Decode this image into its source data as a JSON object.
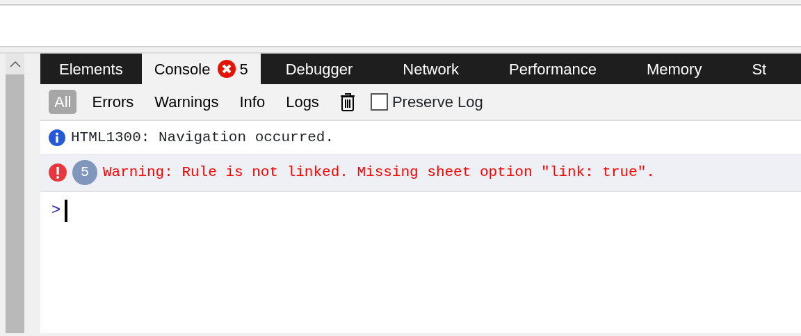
{
  "tabs": [
    {
      "label": "Elements",
      "selected": false
    },
    {
      "label": "Console",
      "selected": true,
      "error_count": "5"
    },
    {
      "label": "Debugger",
      "selected": false
    },
    {
      "label": "Network",
      "selected": false
    },
    {
      "label": "Performance",
      "selected": false
    },
    {
      "label": "Memory",
      "selected": false
    },
    {
      "label": "St",
      "selected": false
    }
  ],
  "filters": [
    {
      "label": "All",
      "selected": true
    },
    {
      "label": "Errors",
      "selected": false
    },
    {
      "label": "Warnings",
      "selected": false
    },
    {
      "label": "Info",
      "selected": false
    },
    {
      "label": "Logs",
      "selected": false
    }
  ],
  "preserve_log": {
    "label": "Preserve Log",
    "checked": false
  },
  "messages": [
    {
      "kind": "info",
      "text": "HTML1300: Navigation occurred."
    },
    {
      "kind": "error",
      "count": "5",
      "text": "Warning: Rule is not linked. Missing sheet option \"link: true\"."
    }
  ],
  "prompt": {
    "symbol": ">"
  }
}
